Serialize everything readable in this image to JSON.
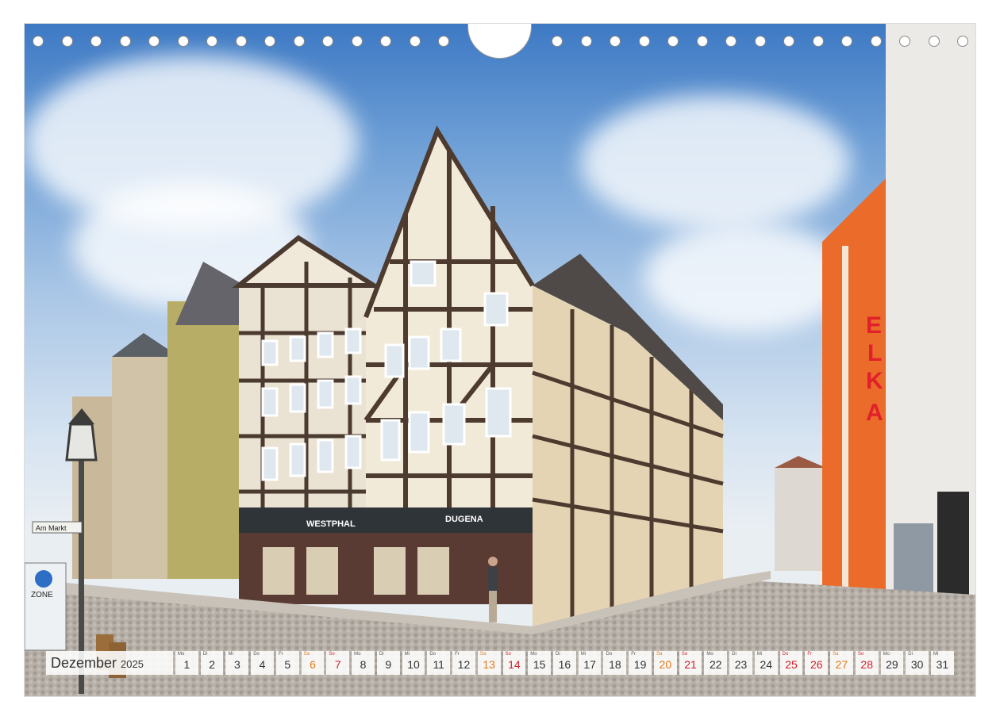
{
  "photo": {
    "signs": {
      "elka": "ELKA",
      "westphal": "WESTPHAL",
      "dugena": "DUGENA",
      "am_markt": "Am Markt",
      "zone": "ZONE"
    }
  },
  "calendar": {
    "month": "Dezember",
    "year": "2025",
    "days": [
      {
        "wd": "Mo",
        "n": "1"
      },
      {
        "wd": "Di",
        "n": "2"
      },
      {
        "wd": "Mi",
        "n": "3"
      },
      {
        "wd": "Do",
        "n": "4"
      },
      {
        "wd": "Fr",
        "n": "5"
      },
      {
        "wd": "Sa",
        "n": "6"
      },
      {
        "wd": "So",
        "n": "7"
      },
      {
        "wd": "Mo",
        "n": "8"
      },
      {
        "wd": "Di",
        "n": "9"
      },
      {
        "wd": "Mi",
        "n": "10"
      },
      {
        "wd": "Do",
        "n": "11"
      },
      {
        "wd": "Fr",
        "n": "12"
      },
      {
        "wd": "Sa",
        "n": "13"
      },
      {
        "wd": "So",
        "n": "14"
      },
      {
        "wd": "Mo",
        "n": "15"
      },
      {
        "wd": "Di",
        "n": "16"
      },
      {
        "wd": "Mi",
        "n": "17"
      },
      {
        "wd": "Do",
        "n": "18"
      },
      {
        "wd": "Fr",
        "n": "19"
      },
      {
        "wd": "Sa",
        "n": "20"
      },
      {
        "wd": "So",
        "n": "21"
      },
      {
        "wd": "Mo",
        "n": "22"
      },
      {
        "wd": "Di",
        "n": "23"
      },
      {
        "wd": "Mi",
        "n": "24"
      },
      {
        "wd": "Do",
        "n": "25"
      },
      {
        "wd": "Fr",
        "n": "26"
      },
      {
        "wd": "Sa",
        "n": "27"
      },
      {
        "wd": "So",
        "n": "28"
      },
      {
        "wd": "Mo",
        "n": "29"
      },
      {
        "wd": "Di",
        "n": "30"
      },
      {
        "wd": "Mi",
        "n": "31"
      }
    ],
    "colors": {
      "saturday": "#e07a1a",
      "sunday_holiday": "#d0202a",
      "weekday": "#333333"
    },
    "red_days": [
      "7",
      "14",
      "21",
      "25",
      "26",
      "28"
    ],
    "orange_days": [
      "6",
      "13",
      "20",
      "27"
    ]
  }
}
